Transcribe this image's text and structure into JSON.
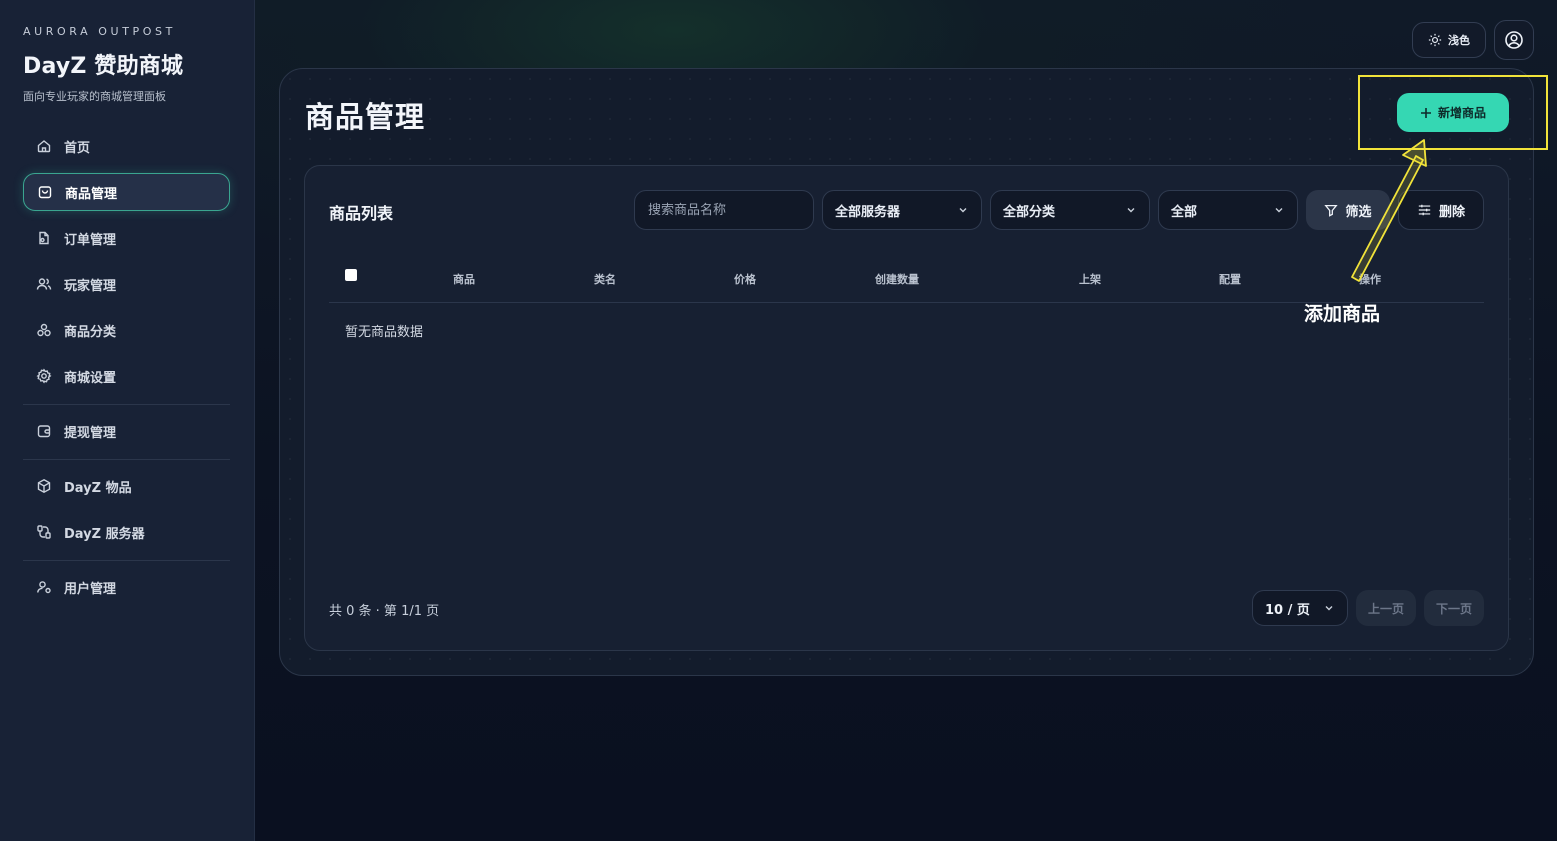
{
  "sidebar": {
    "brand_top": "AURORA OUTPOST",
    "brand_title": "DayZ 赞助商城",
    "brand_sub": "面向专业玩家的商城管理面板",
    "items": [
      {
        "label": "首页",
        "icon": "home-icon"
      },
      {
        "label": "商品管理",
        "icon": "bag-icon",
        "active": true
      },
      {
        "label": "订单管理",
        "icon": "order-icon"
      },
      {
        "label": "玩家管理",
        "icon": "users-icon"
      },
      {
        "label": "商品分类",
        "icon": "category-icon"
      },
      {
        "label": "商城设置",
        "icon": "gear-icon"
      },
      {
        "label": "提现管理",
        "icon": "wallet-icon"
      },
      {
        "label": "DayZ 物品",
        "icon": "box-icon"
      },
      {
        "label": "DayZ 服务器",
        "icon": "server-icon"
      },
      {
        "label": "用户管理",
        "icon": "user-manage-icon"
      }
    ]
  },
  "topbar": {
    "theme_label": "浅色"
  },
  "page": {
    "title": "商品管理",
    "add_button": "新增商品"
  },
  "list": {
    "title": "商品列表",
    "search_placeholder": "搜索商品名称",
    "server_select": "全部服务器",
    "category_select": "全部分类",
    "status_select": "全部",
    "filter_button": "筛选",
    "delete_button": "删除",
    "columns": [
      "商品",
      "类名",
      "价格",
      "创建数量",
      "上架",
      "配置",
      "操作"
    ],
    "empty_text": "暂无商品数据"
  },
  "pagination": {
    "info": "共 0 条 · 第 1/1 页",
    "page_size": "10 / 页",
    "prev": "上一页",
    "next": "下一页"
  },
  "annotation": {
    "label": "添加商品",
    "color": "#f1e33a"
  },
  "colors": {
    "accent": "#35d7b3",
    "active_border": "#3aa590"
  }
}
